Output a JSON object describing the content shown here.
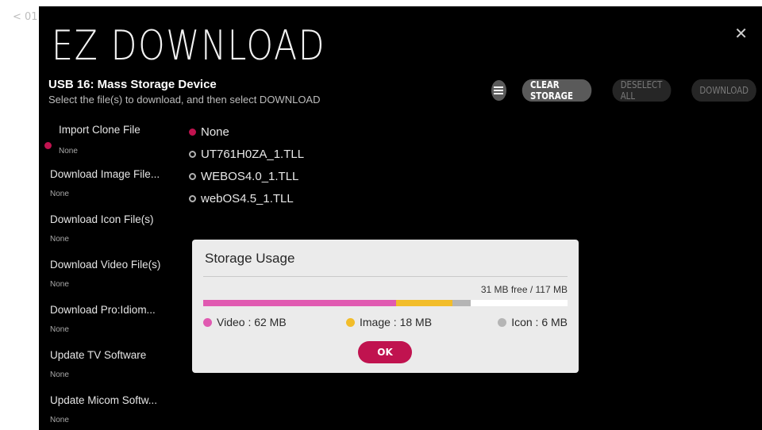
{
  "nav": {
    "back_label": "< 01"
  },
  "header": {
    "title": "EZ DOWNLOAD"
  },
  "device": {
    "name": "USB 16: Mass Storage Device",
    "instruction": "Select the file(s) to download, and then select DOWNLOAD"
  },
  "toolbar": {
    "list_icon": "list-icon",
    "clear_storage": "CLEAR STORAGE",
    "deselect_all": "DESELECT ALL",
    "download": "DOWNLOAD"
  },
  "menu": [
    {
      "label": "Import Clone File",
      "value": "None",
      "selected": true
    },
    {
      "label": "Download Image File...",
      "value": "None"
    },
    {
      "label": "Download Icon File(s)",
      "value": "None"
    },
    {
      "label": "Download Video File(s)",
      "value": "None"
    },
    {
      "label": "Download Pro:Idiom...",
      "value": "None"
    },
    {
      "label": "Update TV Software",
      "value": "None"
    },
    {
      "label": "Update Micom Softw...",
      "value": "None"
    }
  ],
  "files": [
    {
      "name": "None",
      "selected": true
    },
    {
      "name": "UT761H0ZA_1.TLL",
      "selected": false
    },
    {
      "name": "WEBOS4.0_1.TLL",
      "selected": false
    },
    {
      "name": "webOS4.5_1.TLL",
      "selected": false
    }
  ],
  "storage_dialog": {
    "title": "Storage Usage",
    "free_text": "31 MB free / 117 MB",
    "total_mb": 117,
    "free_mb": 31,
    "legend": {
      "video": "Video : 62 MB",
      "image": "Image : 18 MB",
      "icon": "Icon : 6 MB"
    },
    "segments": [
      {
        "name": "video",
        "mb": 62,
        "color": "#e05ab1"
      },
      {
        "name": "image",
        "mb": 18,
        "color": "#f2bd2a"
      },
      {
        "name": "icon",
        "mb": 6,
        "color": "#b5b5b5"
      }
    ],
    "ok_label": "OK"
  },
  "colors": {
    "accent": "#c0134f",
    "video": "#e05ab1",
    "image": "#f2bd2a",
    "icon": "#b5b5b5"
  }
}
